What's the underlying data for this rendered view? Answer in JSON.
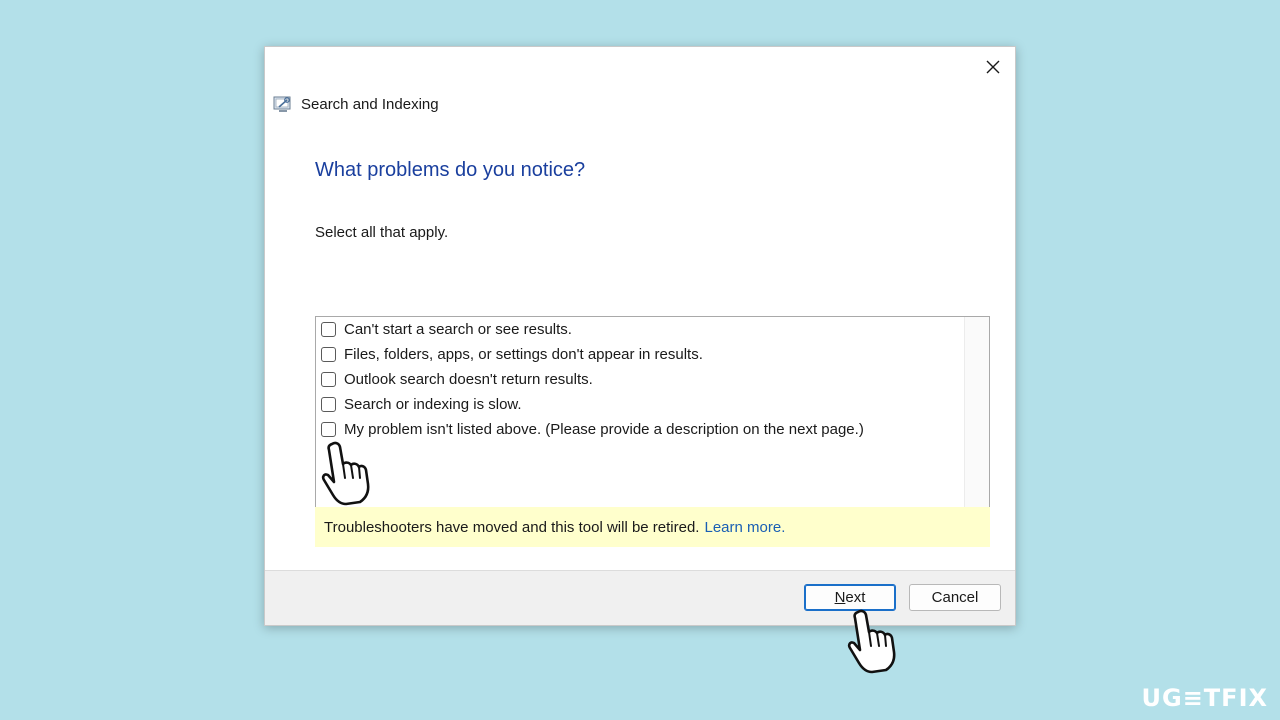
{
  "window": {
    "title": "Search and Indexing",
    "close_icon": "close-icon",
    "app_icon": "troubleshooter-icon"
  },
  "content": {
    "heading": "What problems do you notice?",
    "instruction": "Select all that apply."
  },
  "options": [
    {
      "label": "Can't start a search or see results.",
      "checked": false
    },
    {
      "label": "Files, folders, apps, or settings don't appear in results.",
      "checked": false
    },
    {
      "label": "Outlook search doesn't return results.",
      "checked": false
    },
    {
      "label": "Search or indexing is slow.",
      "checked": false
    },
    {
      "label": "My problem isn't listed above. (Please provide a description on the next page.)",
      "checked": false
    }
  ],
  "banner": {
    "text": "Troubleshooters have moved and this tool will be retired.",
    "link": "Learn more."
  },
  "footer": {
    "next_mnemonic": "N",
    "next_rest": "ext",
    "cancel_label": "Cancel"
  },
  "watermark": "UG≡TFIX",
  "colors": {
    "background": "#b3e0e9",
    "heading": "#1a3f9e",
    "link": "#1a5fb4",
    "banner": "#ffffcc",
    "default_button_border": "#1a6fc9"
  }
}
